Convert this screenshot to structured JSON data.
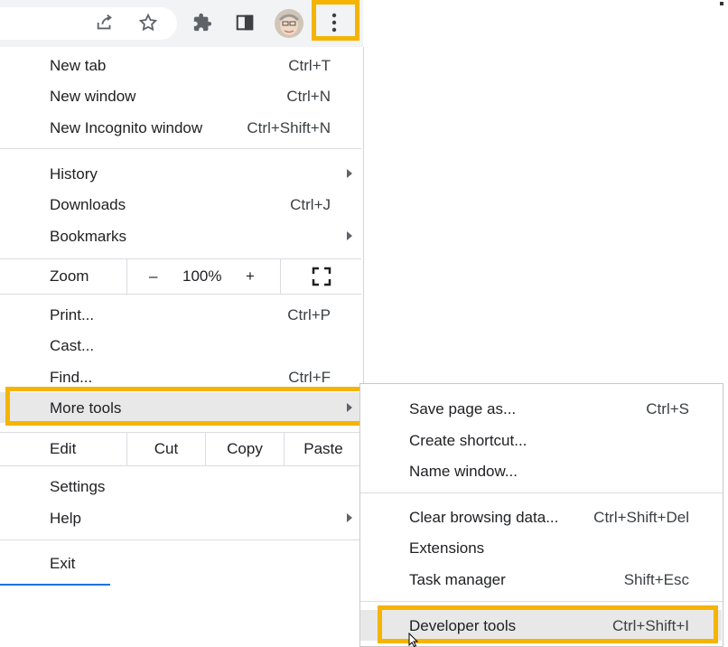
{
  "menu": {
    "new_tab": {
      "label": "New tab",
      "shortcut": "Ctrl+T"
    },
    "new_window": {
      "label": "New window",
      "shortcut": "Ctrl+N"
    },
    "new_incognito": {
      "label": "New Incognito window",
      "shortcut": "Ctrl+Shift+N"
    },
    "history": {
      "label": "History"
    },
    "downloads": {
      "label": "Downloads",
      "shortcut": "Ctrl+J"
    },
    "bookmarks": {
      "label": "Bookmarks"
    },
    "zoom": {
      "label": "Zoom",
      "minus": "–",
      "value": "100%",
      "plus": "+"
    },
    "print": {
      "label": "Print...",
      "shortcut": "Ctrl+P"
    },
    "cast": {
      "label": "Cast..."
    },
    "find": {
      "label": "Find...",
      "shortcut": "Ctrl+F"
    },
    "more_tools": {
      "label": "More tools"
    },
    "edit": {
      "label": "Edit",
      "cut": "Cut",
      "copy": "Copy",
      "paste": "Paste"
    },
    "settings": {
      "label": "Settings"
    },
    "help": {
      "label": "Help"
    },
    "exit": {
      "label": "Exit"
    }
  },
  "submenu": {
    "save_page": {
      "label": "Save page as...",
      "shortcut": "Ctrl+S"
    },
    "create_shortcut": {
      "label": "Create shortcut..."
    },
    "name_window": {
      "label": "Name window..."
    },
    "clear_data": {
      "label": "Clear browsing data...",
      "shortcut": "Ctrl+Shift+Del"
    },
    "extensions": {
      "label": "Extensions"
    },
    "task_manager": {
      "label": "Task manager",
      "shortcut": "Shift+Esc"
    },
    "developer_tools": {
      "label": "Developer tools",
      "shortcut": "Ctrl+Shift+I"
    }
  },
  "toolbar": {
    "icons": [
      "share-icon",
      "star-icon",
      "puzzle-icon",
      "side-panel-icon",
      "avatar",
      "kebab-menu-icon"
    ]
  },
  "colors": {
    "highlight": "#f4b400",
    "hover": "#e8e8e8",
    "toolbar": "#f1f3f4"
  }
}
